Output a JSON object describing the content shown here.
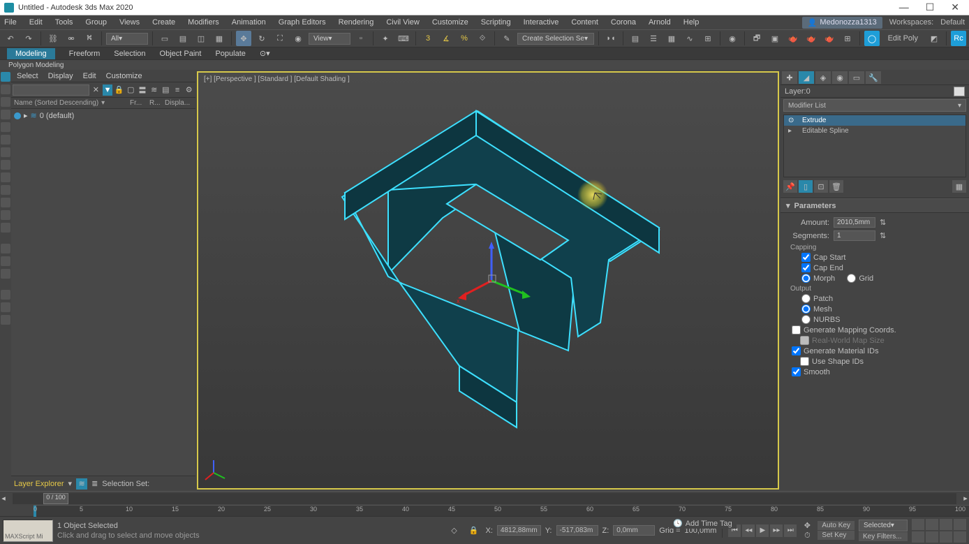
{
  "title": "Untitled - Autodesk 3ds Max 2020",
  "menu": [
    "File",
    "Edit",
    "Tools",
    "Group",
    "Views",
    "Create",
    "Modifiers",
    "Animation",
    "Graph Editors",
    "Rendering",
    "Civil View",
    "Customize",
    "Scripting",
    "Interactive",
    "Content",
    "Corona",
    "Arnold",
    "Help"
  ],
  "user": "Medonozza1313",
  "workspaces_label": "Workspaces:",
  "workspace": "Default",
  "toolbar_filter": "All",
  "view_label": "View",
  "selection_set_dropdown": "Create Selection Se",
  "edit_poly_label": "Edit Poly",
  "ribbon": {
    "tabs": [
      "Modeling",
      "Freeform",
      "Selection",
      "Object Paint",
      "Populate"
    ],
    "active": "Modeling",
    "sub": "Polygon Modeling"
  },
  "scene_tabs": [
    "Select",
    "Display",
    "Edit",
    "Customize"
  ],
  "scene_cols": {
    "name": "Name (Sorted Descending)",
    "c2": "Fr...",
    "c3": "R...",
    "c4": "Displa..."
  },
  "scene_row": "0 (default)",
  "layer_explorer": "Layer Explorer",
  "selection_set_label": "Selection Set:",
  "viewport_label": "[+] [Perspective ] [Standard ] [Default Shading ]",
  "layer_label": "Layer:0",
  "modifier_list_label": "Modifier List",
  "modifiers": [
    "Extrude",
    "Editable Spline"
  ],
  "modifier_selected": "Extrude",
  "rollout": "Parameters",
  "params": {
    "amount_label": "Amount:",
    "amount_value": "2010,5mm",
    "segments_label": "Segments:",
    "segments_value": "1",
    "capping_label": "Capping",
    "cap_start": "Cap Start",
    "cap_end": "Cap End",
    "morph": "Morph",
    "grid": "Grid",
    "output_label": "Output",
    "patch": "Patch",
    "mesh": "Mesh",
    "nurbs": "NURBS",
    "gen_mapping": "Generate Mapping Coords.",
    "real_world": "Real-World Map Size",
    "gen_material": "Generate Material IDs",
    "use_shape": "Use Shape IDs",
    "smooth": "Smooth"
  },
  "time_slider": "0 / 100",
  "ticks": [
    0,
    5,
    10,
    15,
    20,
    25,
    30,
    35,
    40,
    45,
    50,
    55,
    60,
    65,
    70,
    75,
    80,
    85,
    90,
    95,
    100
  ],
  "status": {
    "selected": "1 Object Selected",
    "hint": "Click and drag to select and move objects",
    "maxscript": "MAXScript Mi"
  },
  "coords": {
    "x_label": "X:",
    "x": "4812,88mm",
    "y_label": "Y:",
    "y": "-517,083m",
    "z_label": "Z:",
    "z": "0,0mm",
    "grid_label": "Grid =",
    "grid": "100,0mm"
  },
  "anim": {
    "auto_key": "Auto Key",
    "set_key": "Set Key",
    "selected": "Selected",
    "key_filters": "Key Filters..."
  },
  "add_time_tag": "Add Time Tag"
}
